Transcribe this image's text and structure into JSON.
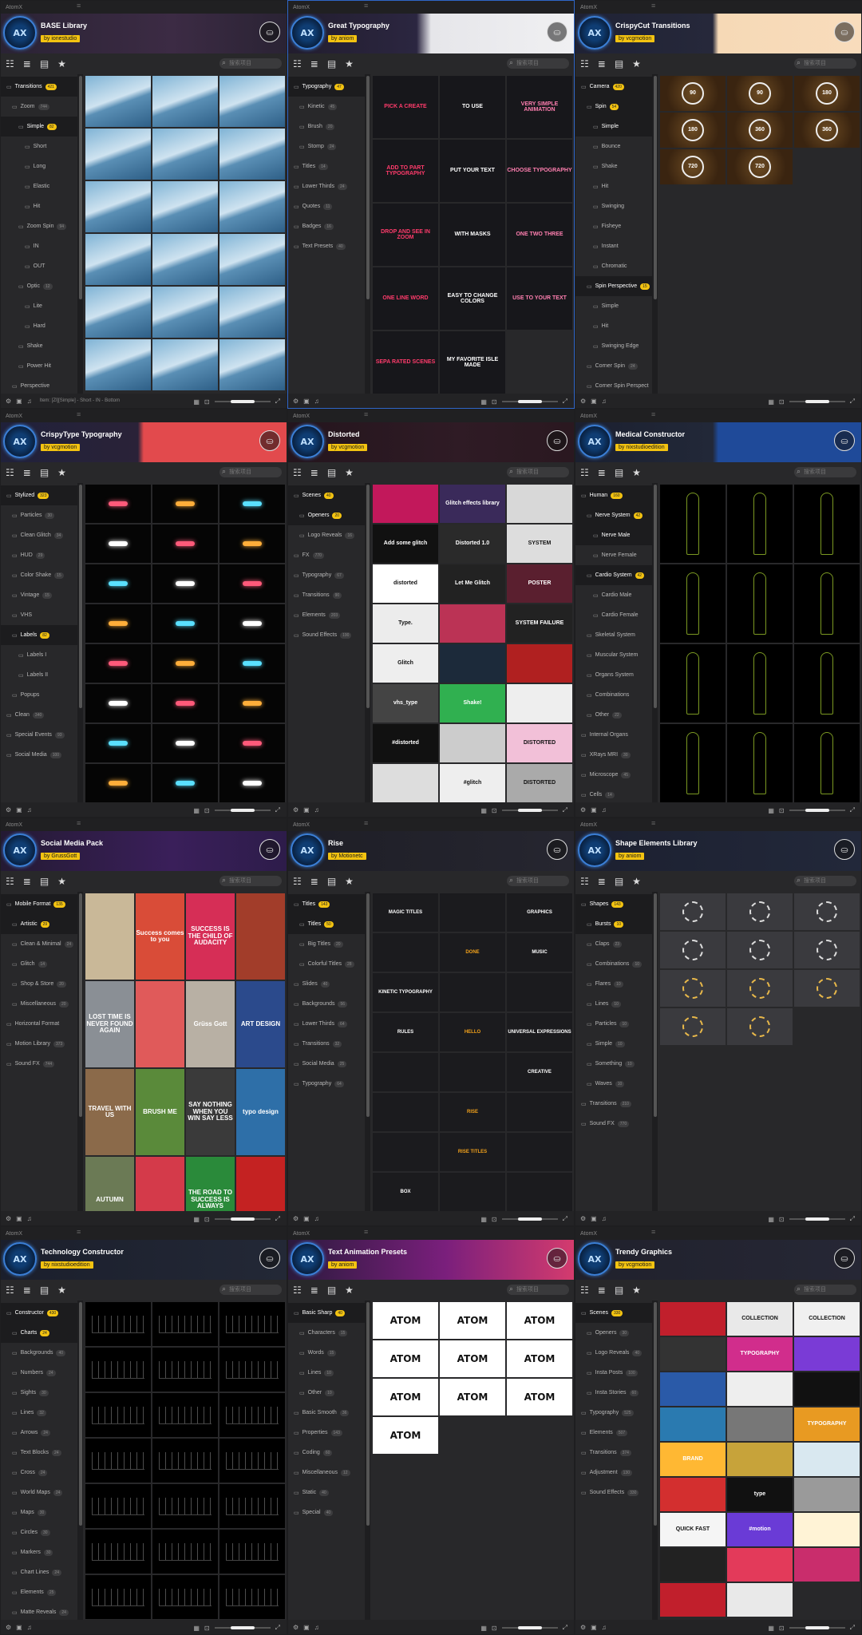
{
  "app_title": "AtomX",
  "search_placeholder": "搜索项目",
  "panels": [
    {
      "name": "BASE Library",
      "author": "by ionestudio",
      "banner": "linear-gradient(90deg,#2a2334 0%,#3c2b44 60%,#2a2334 100%)",
      "active": false,
      "side": [
        [
          "Transitions",
          "421",
          0,
          true
        ],
        [
          "Zoom",
          "744",
          1,
          false
        ],
        [
          "Simple",
          "82",
          2,
          true
        ],
        [
          "Short",
          "",
          3,
          false
        ],
        [
          "Long",
          "",
          3,
          false
        ],
        [
          "Elastic",
          "",
          3,
          false
        ],
        [
          "Hit",
          "",
          3,
          false
        ],
        [
          "Zoom Spin",
          "94",
          2,
          false
        ],
        [
          "IN",
          "",
          3,
          false
        ],
        [
          "OUT",
          "",
          3,
          false
        ],
        [
          "Optic",
          "12",
          2,
          false
        ],
        [
          "Lite",
          "",
          3,
          false
        ],
        [
          "Hard",
          "",
          3,
          false
        ],
        [
          "Shake",
          "",
          2,
          false
        ],
        [
          "Power Hit",
          "",
          2,
          false
        ],
        [
          "Perspective",
          "",
          1,
          false
        ]
      ],
      "status": "Item: [Zl][Simple] - Short - IN - Bottom",
      "cols": 3,
      "rows": 6,
      "style": "photo",
      "cells": []
    },
    {
      "name": "Great Typography",
      "author": "by aniom",
      "banner": "linear-gradient(90deg,#221d2e 0%,#2b2640 45%,#e6e6ea 50%,#f0f0f2 100%)",
      "active": true,
      "side": [
        [
          "Typography",
          "47",
          0,
          true
        ],
        [
          "Kinetic",
          "45",
          1,
          false
        ],
        [
          "Brush",
          "20",
          1,
          false
        ],
        [
          "Stomp",
          "24",
          1,
          false
        ],
        [
          "Titles",
          "14",
          0,
          false
        ],
        [
          "Lower Thirds",
          "24",
          0,
          false
        ],
        [
          "Quotes",
          "11",
          0,
          false
        ],
        [
          "Badges",
          "16",
          0,
          false
        ],
        [
          "Text Presets",
          "40",
          0,
          false
        ]
      ],
      "status": "",
      "cols": 3,
      "rows": 5,
      "style": "typo",
      "cells": [
        "PICK A CREATE",
        "TO USE",
        "VERY SIMPLE ANIMATION",
        "ADD TO PART TYPOGRAPHY",
        "PUT YOUR TEXT",
        "CHOOSE TYPOGRAPHY",
        "DROP AND SEE IN ZOOM",
        "WITH MASKS",
        "ONE TWO THREE",
        "ONE LINE WORD",
        "EASY TO CHANGE COLORS",
        "USE TO YOUR TEXT",
        "SEPA RATED SCENES",
        "MY FAVORITE ISLE MADE"
      ]
    },
    {
      "name": "CrispyCut Transitions",
      "author": "by vcgmotion",
      "banner": "linear-gradient(90deg,#1f2235 0%,#26283a 48%,#f6d9b6 50%,#f8dcbc 100%)",
      "active": false,
      "side": [
        [
          "Camera",
          "420",
          0,
          true
        ],
        [
          "Spin",
          "54",
          1,
          true
        ],
        [
          "Simple",
          "",
          2,
          true
        ],
        [
          "Bounce",
          "",
          2,
          false
        ],
        [
          "Shake",
          "",
          2,
          false
        ],
        [
          "Hit",
          "",
          2,
          false
        ],
        [
          "Swinging",
          "",
          2,
          false
        ],
        [
          "Fisheye",
          "",
          2,
          false
        ],
        [
          "Instant",
          "",
          2,
          false
        ],
        [
          "Chromatic",
          "",
          2,
          false
        ],
        [
          "Spin Perspective",
          "15",
          1,
          true
        ],
        [
          "Simple",
          "",
          2,
          false
        ],
        [
          "Hit",
          "",
          2,
          false
        ],
        [
          "Swinging Edge",
          "",
          2,
          false
        ],
        [
          "Corner Spin",
          "24",
          1,
          false
        ],
        [
          "Corner Spin Perspect",
          "",
          1,
          false
        ]
      ],
      "status": "",
      "cols": 3,
      "rows": 3,
      "style": "spin",
      "cells": [
        "90",
        "90",
        "180",
        "180",
        "360",
        "360",
        "720",
        "720"
      ]
    },
    {
      "name": "CrispyType Typography",
      "author": "by vcgmotion",
      "banner": "linear-gradient(90deg,#20213a 0%,#2a2238 48%,#e24a4d 50%,#e24a4d 100%)",
      "active": false,
      "side": [
        [
          "Stylized",
          "323",
          0,
          true
        ],
        [
          "Particles",
          "30",
          1,
          false
        ],
        [
          "Clean Glitch",
          "34",
          1,
          false
        ],
        [
          "HUD",
          "29",
          1,
          false
        ],
        [
          "Color Shake",
          "15",
          1,
          false
        ],
        [
          "Vintage",
          "15",
          1,
          false
        ],
        [
          "VHS",
          "",
          1,
          false
        ],
        [
          "Labels",
          "82",
          1,
          true
        ],
        [
          "Labels I",
          "",
          2,
          false
        ],
        [
          "Labels II",
          "",
          2,
          false
        ],
        [
          "Popups",
          "",
          1,
          false
        ],
        [
          "Clean",
          "340",
          0,
          false
        ],
        [
          "Special Events",
          "93",
          0,
          false
        ],
        [
          "Social Media",
          "100",
          0,
          false
        ]
      ],
      "status": "",
      "cols": 3,
      "rows": 8,
      "style": "dark",
      "cells": []
    },
    {
      "name": "Distorted",
      "author": "by vcgmotion",
      "banner": "linear-gradient(90deg,#24151d 0%,#2f1b25 60%,#2a1820 100%)",
      "active": false,
      "side": [
        [
          "Scenes",
          "40",
          0,
          true
        ],
        [
          "Openers",
          "20",
          1,
          true
        ],
        [
          "Logo Reveals",
          "16",
          1,
          false
        ],
        [
          "FX",
          "770",
          0,
          false
        ],
        [
          "Typography",
          "67",
          0,
          false
        ],
        [
          "Transitions",
          "90",
          0,
          false
        ],
        [
          "Elements",
          "203",
          0,
          false
        ],
        [
          "Sound Effects",
          "190",
          0,
          false
        ]
      ],
      "status": "",
      "cols": 3,
      "rows": 8,
      "style": "glitch",
      "cells": [
        "",
        "Glitch effects library",
        "",
        "Add some glitch",
        "Distorted 1.0",
        "SYSTEM",
        "distorted",
        "Let Me Glitch",
        "POSTER",
        "Type.",
        "",
        "SYSTEM FAILURE",
        "Glitch",
        "",
        "",
        "vhs_type",
        "Shake!",
        "",
        "#distorted",
        "",
        "DISTORTED",
        "",
        "#glitch",
        "DISTORTED"
      ]
    },
    {
      "name": "Medical Constructor",
      "author": "by nixstudioedition",
      "banner": "linear-gradient(90deg,#1b2030 0%,#222838 48%,#1f4a99 50%,#1f4a99 100%)",
      "active": false,
      "side": [
        [
          "Human",
          "160",
          0,
          true
        ],
        [
          "Nerve System",
          "42",
          1,
          true
        ],
        [
          "Nerve Male",
          "",
          2,
          true
        ],
        [
          "Nerve Female",
          "",
          2,
          false
        ],
        [
          "Cardio System",
          "42",
          1,
          true
        ],
        [
          "Cardio Male",
          "",
          2,
          false
        ],
        [
          "Cardio Female",
          "",
          2,
          false
        ],
        [
          "Skeletal System",
          "",
          1,
          false
        ],
        [
          "Muscular System",
          "",
          1,
          false
        ],
        [
          "Organs System",
          "",
          1,
          false
        ],
        [
          "Combinations",
          "",
          1,
          false
        ],
        [
          "Other",
          "22",
          1,
          false
        ],
        [
          "Internal Organs",
          "",
          0,
          false
        ],
        [
          "XRays MRI",
          "30",
          0,
          false
        ],
        [
          "Microscope",
          "45",
          0,
          false
        ],
        [
          "Cells",
          "14",
          0,
          false
        ]
      ],
      "status": "",
      "cols": 3,
      "rows": 4,
      "style": "body",
      "cells": []
    },
    {
      "name": "Social Media Pack",
      "author": "by GrussGott",
      "banner": "linear-gradient(90deg,#241a33 0%,#3a1f5a 60%,#2d1c4a 100%)",
      "active": false,
      "side": [
        [
          "Mobile Format",
          "135",
          0,
          true
        ],
        [
          "Artistic",
          "29",
          1,
          true
        ],
        [
          "Clean & Minimal",
          "24",
          1,
          false
        ],
        [
          "Glitch",
          "14",
          1,
          false
        ],
        [
          "Shop & Store",
          "20",
          1,
          false
        ],
        [
          "Miscellaneous",
          "20",
          1,
          false
        ],
        [
          "Horizontal Format",
          "",
          0,
          false
        ],
        [
          "Motion Library",
          "373",
          0,
          false
        ],
        [
          "Sound FX",
          "744",
          0,
          false
        ]
      ],
      "status": "",
      "cols": 4,
      "rows": 4,
      "style": "social",
      "cells": [
        "",
        "Success comes to you",
        "SUCCESS IS THE CHILD OF AUDACITY",
        "",
        "LOST TIME IS NEVER FOUND AGAIN",
        "",
        "Grüss Gott",
        "ART DESIGN",
        "TRAVEL WITH US",
        "BRUSH ME",
        "SAY NOTHING WHEN YOU WIN SAY LESS",
        "typo design",
        "AUTUMN",
        "",
        "THE ROAD TO SUCCESS IS ALWAYS",
        "",
        ""
      ]
    },
    {
      "name": "Rise",
      "author": "by Motionetc",
      "banner": "linear-gradient(90deg,#1e1e26 0%,#262630 100%)",
      "active": false,
      "side": [
        [
          "Titles",
          "143",
          0,
          true
        ],
        [
          "Titles",
          "50",
          1,
          true
        ],
        [
          "Big Titles",
          "20",
          1,
          false
        ],
        [
          "Colorful Titles",
          "28",
          1,
          false
        ],
        [
          "Slides",
          "40",
          0,
          false
        ],
        [
          "Backgrounds",
          "56",
          0,
          false
        ],
        [
          "Lower Thirds",
          "64",
          0,
          false
        ],
        [
          "Transitions",
          "32",
          0,
          false
        ],
        [
          "Social Media",
          "25",
          0,
          false
        ],
        [
          "Typography",
          "64",
          0,
          false
        ]
      ],
      "status": "",
      "cols": 3,
      "rows": 8,
      "style": "rise",
      "cells": [
        "MAGIC TITLES",
        "",
        "GRAPHICS",
        "",
        "DONE",
        "MUSIC",
        "KINETIC TYPOGRAPHY",
        "",
        "",
        "RULES",
        "HELLO",
        "UNIVERSAL EXPRESSIONS",
        "",
        "",
        "CREATIVE",
        "",
        "RISE",
        "",
        "",
        "RISE TITLES",
        "",
        "BOX",
        "",
        ""
      ]
    },
    {
      "name": "Shape Elements Library",
      "author": "by aniom",
      "banner": "linear-gradient(90deg,#1c2030 0%,#22283a 100%)",
      "active": false,
      "side": [
        [
          "Shapes",
          "143",
          0,
          true
        ],
        [
          "Bursts",
          "10",
          1,
          true
        ],
        [
          "Claps",
          "23",
          1,
          false
        ],
        [
          "Combinations",
          "10",
          1,
          false
        ],
        [
          "Flares",
          "10",
          1,
          false
        ],
        [
          "Lines",
          "10",
          1,
          false
        ],
        [
          "Particles",
          "10",
          1,
          false
        ],
        [
          "Simple",
          "10",
          1,
          false
        ],
        [
          "Something",
          "10",
          1,
          false
        ],
        [
          "Waves",
          "10",
          1,
          false
        ],
        [
          "Transitions",
          "210",
          0,
          false
        ],
        [
          "Sound FX",
          "770",
          0,
          false
        ]
      ],
      "status": "",
      "cols": 3,
      "rows": 4,
      "style": "burst",
      "cells": [
        "",
        "",
        "",
        "",
        "",
        "",
        "",
        "",
        "",
        "",
        ""
      ]
    },
    {
      "name": "Technology Constructor",
      "author": "by nixstudioedition",
      "banner": "linear-gradient(90deg,#1b1f2c 0%,#232836 100%)",
      "active": false,
      "side": [
        [
          "Constructor",
          "430",
          0,
          true
        ],
        [
          "Charts",
          "24",
          1,
          true
        ],
        [
          "Backgrounds",
          "40",
          1,
          false
        ],
        [
          "Numbers",
          "24",
          1,
          false
        ],
        [
          "Sights",
          "30",
          1,
          false
        ],
        [
          "Lines",
          "32",
          1,
          false
        ],
        [
          "Arrows",
          "24",
          1,
          false
        ],
        [
          "Text Blocks",
          "24",
          1,
          false
        ],
        [
          "Cross",
          "24",
          1,
          false
        ],
        [
          "World Maps",
          "24",
          1,
          false
        ],
        [
          "Maps",
          "30",
          1,
          false
        ],
        [
          "Circles",
          "30",
          1,
          false
        ],
        [
          "Markers",
          "30",
          1,
          false
        ],
        [
          "Chart Lines",
          "24",
          1,
          false
        ],
        [
          "Elements",
          "25",
          1,
          false
        ],
        [
          "Matte Reveals",
          "24",
          1,
          false
        ]
      ],
      "status": "",
      "cols": 3,
      "rows": 7,
      "style": "tech",
      "cells": []
    },
    {
      "name": "Text Animation Presets",
      "author": "by aniom",
      "banner": "linear-gradient(90deg,#2b1a3d 0%,#7a1f7c 55%,#d43b6e 100%)",
      "active": false,
      "side": [
        [
          "Basic Sharp",
          "40",
          0,
          true
        ],
        [
          "Characters",
          "15",
          1,
          false
        ],
        [
          "Words",
          "15",
          1,
          false
        ],
        [
          "Lines",
          "10",
          1,
          false
        ],
        [
          "Other",
          "10",
          1,
          false
        ],
        [
          "Basic Smooth",
          "36",
          0,
          false
        ],
        [
          "Properties",
          "143",
          0,
          false
        ],
        [
          "Coding",
          "60",
          0,
          false
        ],
        [
          "Miscellaneous",
          "12",
          0,
          false
        ],
        [
          "Static",
          "40",
          0,
          false
        ],
        [
          "Special",
          "40",
          0,
          false
        ]
      ],
      "status": "",
      "cols": 3,
      "rows": 5,
      "style": "atom",
      "cells": [
        "ATOM",
        "ATOM",
        "ATOM",
        "ATOM",
        "ATOM",
        "ATOM",
        "ATOM",
        "ATOM",
        "ATOM",
        "ATOM"
      ]
    },
    {
      "name": "Trendy Graphics",
      "author": "by vcgmotion",
      "banner": "linear-gradient(90deg,#20212c 0%,#262735 100%)",
      "active": false,
      "side": [
        [
          "Scenes",
          "330",
          0,
          true
        ],
        [
          "Openers",
          "30",
          1,
          false
        ],
        [
          "Logo Reveals",
          "40",
          1,
          false
        ],
        [
          "Insta Posts",
          "100",
          1,
          false
        ],
        [
          "Insta Stories",
          "60",
          1,
          false
        ],
        [
          "Typography",
          "525",
          0,
          false
        ],
        [
          "Elements",
          "507",
          0,
          false
        ],
        [
          "Transitions",
          "374",
          0,
          false
        ],
        [
          "Adjustment",
          "130",
          0,
          false
        ],
        [
          "Sound Effects",
          "330",
          0,
          false
        ]
      ],
      "status": "",
      "cols": 3,
      "rows": 9,
      "style": "trendy",
      "cells": [
        "",
        "COLLECTION",
        "COLLECTION",
        "",
        "TYPOGRAPHY",
        "",
        "",
        "",
        "",
        "",
        "",
        "TYPOGRAPHY",
        "BRAND",
        "",
        "",
        "",
        "type",
        "",
        "QUICK FAST",
        "#motion",
        "",
        "",
        "",
        "",
        "",
        ""
      ]
    }
  ]
}
